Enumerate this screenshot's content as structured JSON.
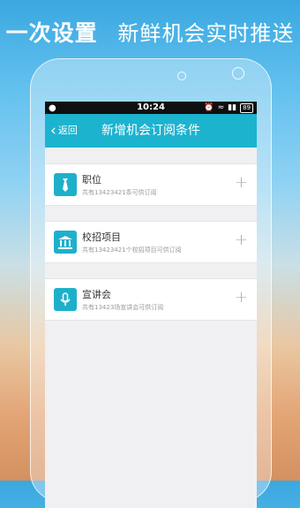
{
  "headline": {
    "bold": "一次设置",
    "light": "新鲜机会实时推送"
  },
  "statusbar": {
    "time": "10:24",
    "battery": "89"
  },
  "nav": {
    "back_label": "返回",
    "title": "新增机会订阅条件"
  },
  "items": [
    {
      "name": "职位",
      "desc": "共有13423421条可供订阅",
      "icon": "tie-icon"
    },
    {
      "name": "校招项目",
      "desc": "共有13423421个校招项目可供订阅",
      "icon": "building-icon"
    },
    {
      "name": "宣讲会",
      "desc": "共有13423场宣讲会可供订阅",
      "icon": "microphone-icon"
    }
  ],
  "colors": {
    "accent": "#1cb3cf",
    "statusbar": "#0f0f0f"
  }
}
